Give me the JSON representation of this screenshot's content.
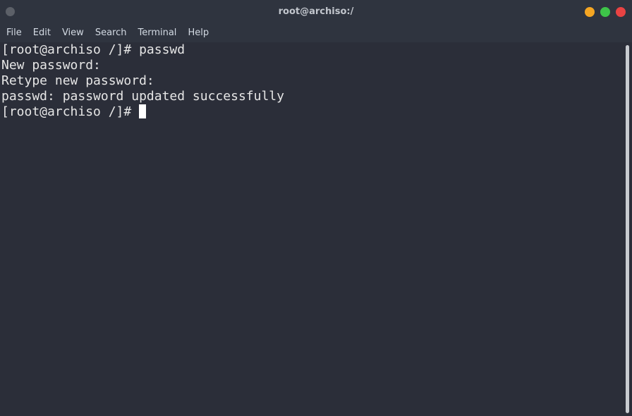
{
  "window": {
    "title": "root@archiso:/"
  },
  "menubar": {
    "items": [
      "File",
      "Edit",
      "View",
      "Search",
      "Terminal",
      "Help"
    ]
  },
  "terminal": {
    "lines": [
      "[root@archiso /]# passwd",
      "New password:",
      "Retype new password:",
      "passwd: password updated successfully"
    ],
    "prompt": "[root@archiso /]# "
  },
  "colors": {
    "window_bg": "#2f343f",
    "terminal_bg": "#2b2e39",
    "terminal_fg": "#e6e6e6",
    "minimize": "#f5a623",
    "maximize": "#3ec449",
    "close": "#e94343"
  }
}
